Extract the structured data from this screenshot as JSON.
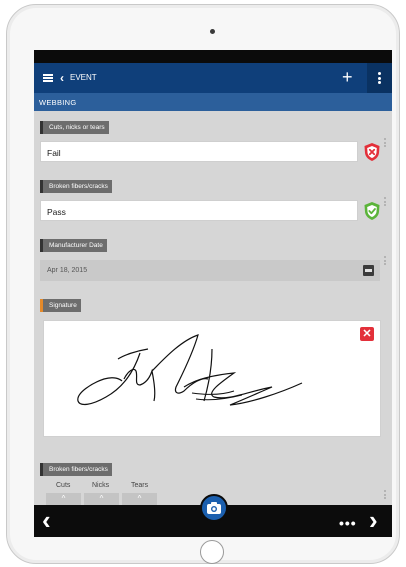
{
  "header": {
    "title": "EVENT",
    "back_icon": "chevron-left-icon",
    "menu_icon": "hamburger-icon",
    "add_icon": "plus-icon",
    "overflow_icon": "kebab-icon"
  },
  "section": {
    "title": "WEBBING"
  },
  "fields": [
    {
      "label": "Cuts, nicks or tears",
      "value": "Fail",
      "status": "fail",
      "status_icon": "shield-x-icon",
      "status_color": "#e3303a"
    },
    {
      "label": "Broken fibers/cracks",
      "value": "Pass",
      "status": "pass",
      "status_icon": "shield-check-icon",
      "status_color": "#5bb43a"
    }
  ],
  "manufacturer_date": {
    "label": "Manufacturer Date",
    "value": "Apr 18, 2015",
    "icon": "calendar-icon"
  },
  "signature": {
    "label": "Signature",
    "delete_icon": "close-icon",
    "delete_color": "#e3303a"
  },
  "counters": {
    "label": "Broken fibers/cracks",
    "columns": [
      "Cuts",
      "Nicks",
      "Tears"
    ]
  },
  "bottom_bar": {
    "back_icon": "chevron-left-icon",
    "camera_icon": "camera-icon",
    "more_icon": "more-horizontal-icon",
    "forward_icon": "chevron-right-icon"
  },
  "colors": {
    "header": "#0f3f7a",
    "section_bar": "#2c5f9b",
    "accent_orange": "#e58a2a"
  }
}
